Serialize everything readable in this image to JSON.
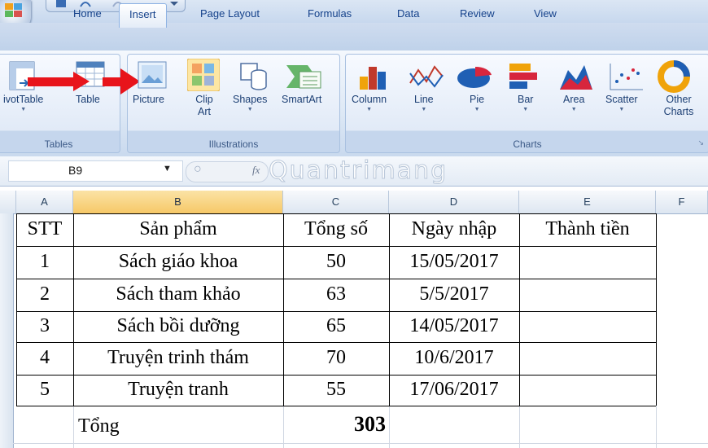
{
  "ribbon": {
    "tabs": [
      "Home",
      "Insert",
      "Page Layout",
      "Formulas",
      "Data",
      "Review",
      "View"
    ],
    "active_tab": "Insert",
    "groups": {
      "tables": {
        "label": "Tables",
        "buttons": [
          "ivotTable",
          "Table"
        ]
      },
      "illustrations": {
        "label": "Illustrations",
        "buttons": [
          "Picture",
          "Clip Art",
          "Shapes",
          "SmartArt"
        ]
      },
      "charts": {
        "label": "Charts",
        "buttons": [
          "Column",
          "Line",
          "Pie",
          "Bar",
          "Area",
          "Scatter",
          "Other Charts"
        ]
      }
    }
  },
  "formula_bar": {
    "name_box": "B9",
    "fx_label": "fx",
    "watermark": "Quantrimang"
  },
  "columns": [
    "A",
    "B",
    "C",
    "D",
    "E",
    "F"
  ],
  "selected_column": "B",
  "sheet": {
    "headers": [
      "STT",
      "Sản phẩm",
      "Tổng số",
      "Ngày nhập",
      "Thành tiền"
    ],
    "rows": [
      [
        "1",
        "Sách giáo khoa",
        "50",
        "15/05/2017",
        ""
      ],
      [
        "2",
        "Sách tham khảo",
        "63",
        "5/5/2017",
        ""
      ],
      [
        "3",
        "Sách bồi dưỡng",
        "65",
        "14/05/2017",
        ""
      ],
      [
        "4",
        "Truyện trinh thám",
        "70",
        "10/6/2017",
        ""
      ],
      [
        "5",
        "Truyện tranh",
        "55",
        "17/06/2017",
        ""
      ]
    ],
    "total_label": "Tổng",
    "total_value": "303"
  },
  "colors": {
    "arrow": "#e8141b",
    "selected_column": "#f7cf74",
    "ribbon_text": "#15428b"
  }
}
